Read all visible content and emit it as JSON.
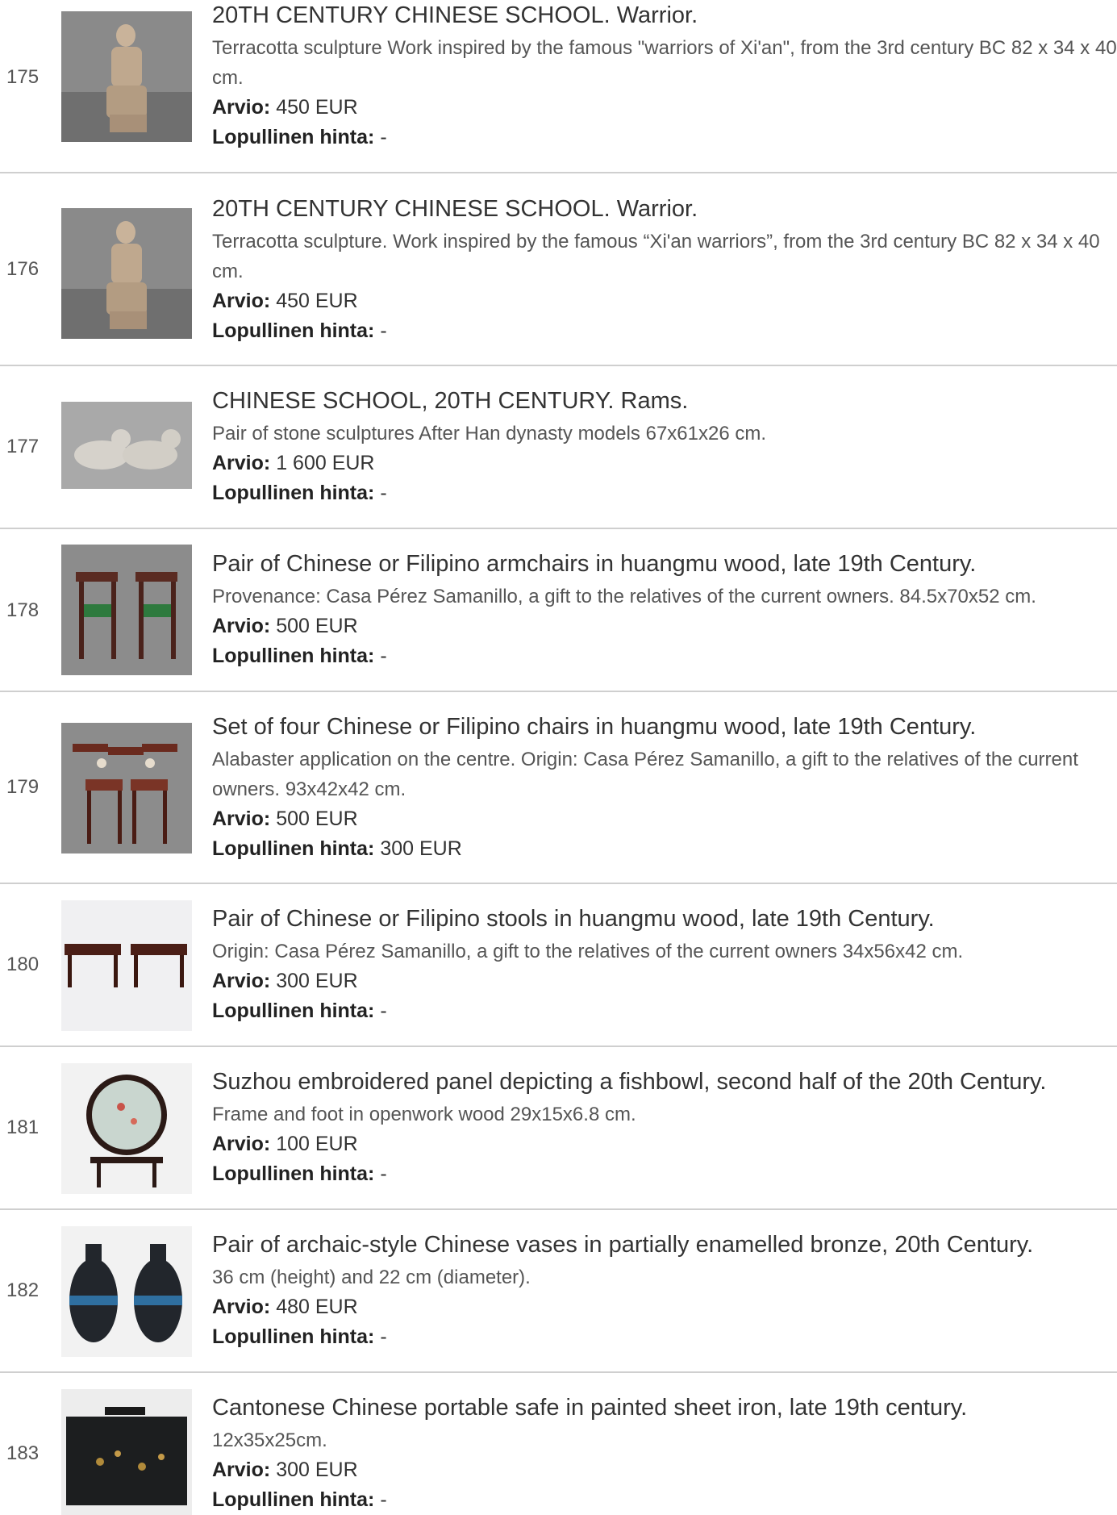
{
  "labels": {
    "estimate": "Arvio:",
    "final_price": "Lopullinen hinta:"
  },
  "lots": [
    {
      "number": "175",
      "title": "20TH CENTURY CHINESE SCHOOL. Warrior.",
      "description": "Terracotta sculpture Work inspired by the famous \"warriors of Xi'an\", from the 3rd century BC 82 x 34 x 40 cm.",
      "estimate": "450 EUR",
      "final_price": "-",
      "image_icon": "terracotta-warrior-image"
    },
    {
      "number": "176",
      "title": "20TH CENTURY CHINESE SCHOOL. Warrior.",
      "description": "Terracotta sculpture. Work inspired by the famous “Xi'an warriors”, from the 3rd century BC 82 x 34 x 40 cm.",
      "estimate": "450 EUR",
      "final_price": "-",
      "image_icon": "terracotta-warrior-image"
    },
    {
      "number": "177",
      "title": "CHINESE SCHOOL, 20TH CENTURY. Rams.",
      "description": "Pair of stone sculptures After Han dynasty models 67x61x26 cm.",
      "estimate": "1 600 EUR",
      "final_price": "-",
      "image_icon": "stone-rams-image"
    },
    {
      "number": "178",
      "title": "Pair of Chinese or Filipino armchairs in huangmu wood, late 19th Century.",
      "description": "Provenance: Casa Pérez Samanillo, a gift to the relatives of the current owners. 84.5x70x52 cm.",
      "estimate": "500 EUR",
      "final_price": "-",
      "image_icon": "armchairs-image"
    },
    {
      "number": "179",
      "title": "Set of four Chinese or Filipino chairs in huangmu wood, late 19th Century.",
      "description": "Alabaster application on the centre. Origin: Casa Pérez Samanillo, a gift to the relatives of the current owners. 93x42x42 cm.",
      "estimate": "500 EUR",
      "final_price": "300 EUR",
      "image_icon": "chairs-image"
    },
    {
      "number": "180",
      "title": "Pair of Chinese or Filipino stools in huangmu wood, late 19th Century.",
      "description": "Origin: Casa Pérez Samanillo, a gift to the relatives of the current owners 34x56x42 cm.",
      "estimate": "300 EUR",
      "final_price": "-",
      "image_icon": "stools-image"
    },
    {
      "number": "181",
      "title": "Suzhou embroidered panel depicting a fishbowl, second half of the 20th Century.",
      "description": "Frame and foot in openwork wood 29x15x6.8 cm.",
      "estimate": "100 EUR",
      "final_price": "-",
      "image_icon": "embroidered-panel-image"
    },
    {
      "number": "182",
      "title": "Pair of archaic-style Chinese vases in partially enamelled bronze, 20th Century.",
      "description": "36 cm (height) and 22 cm (diameter).",
      "estimate": "480 EUR",
      "final_price": "-",
      "image_icon": "bronze-vases-image"
    },
    {
      "number": "183",
      "title": "Cantonese Chinese portable safe in painted sheet iron, late 19th century.",
      "description": "12x35x25cm.",
      "estimate": "300 EUR",
      "final_price": "-",
      "image_icon": "iron-safe-image"
    }
  ]
}
